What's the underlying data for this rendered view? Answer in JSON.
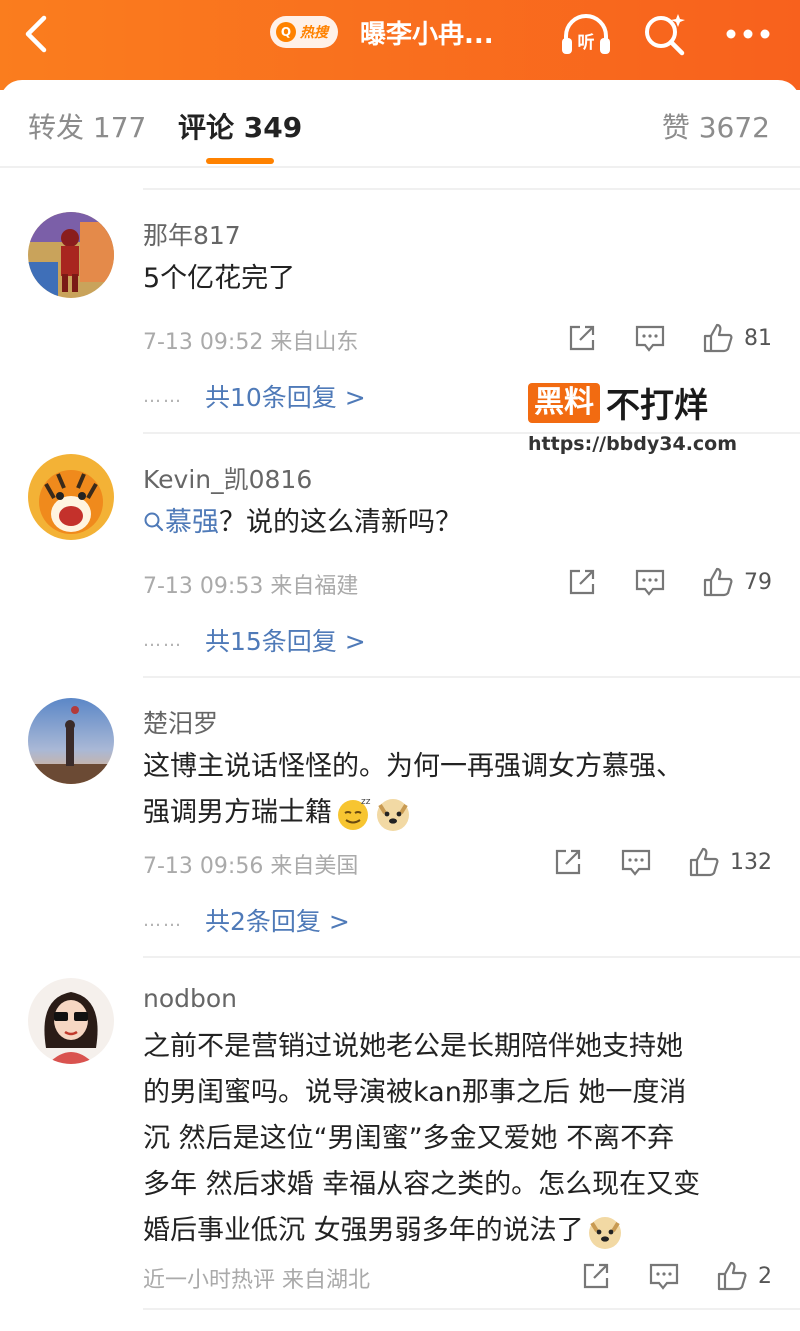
{
  "header": {
    "hot_label": "热搜",
    "hot_q": "Q",
    "title": "曝李小冉...",
    "listen_label": "听",
    "brand_color": "#fa7d1e"
  },
  "tabs": {
    "forward": "转发 177",
    "comment": "评论 349",
    "like": "赞 3672"
  },
  "comments": [
    {
      "user": "那年817",
      "text": "5个亿花完了",
      "meta": "7-13 09:52  来自山东",
      "likes": "81",
      "dots": "……",
      "replies": "共10条回复 >"
    },
    {
      "user": "Kevin_凯0816",
      "search_term": "慕强",
      "text_after": "？说的这么清新吗？",
      "meta": "7-13 09:53  来自福建",
      "likes": "79",
      "dots": "……",
      "replies": "共15条回复 >"
    },
    {
      "user": "楚汨罗",
      "line1": "这博主说话怪怪的。为何一再强调女方慕强、",
      "line2": "强调男方瑞士籍",
      "meta": "7-13 09:56  来自美国",
      "likes": "132",
      "dots": "……",
      "replies": "共2条回复 >"
    },
    {
      "user": "nodbon",
      "line1": "之前不是营销过说她老公是长期陪伴她支持她",
      "line2": "的男闺蜜吗。说导演被kan那事之后 她一度消",
      "line3": "沉 然后是这位“男闺蜜”多金又爱她 不离不弃",
      "line4": "多年 然后求婚 幸福从容之类的。怎么现在又变",
      "line5": "婚后事业低沉 女强男弱多年的说法了",
      "meta": "近一小时热评  来自湖北",
      "likes": "2"
    }
  ],
  "watermark": {
    "badge": "黑料",
    "text": "不打烊",
    "url": "https://bbdy34.com"
  }
}
